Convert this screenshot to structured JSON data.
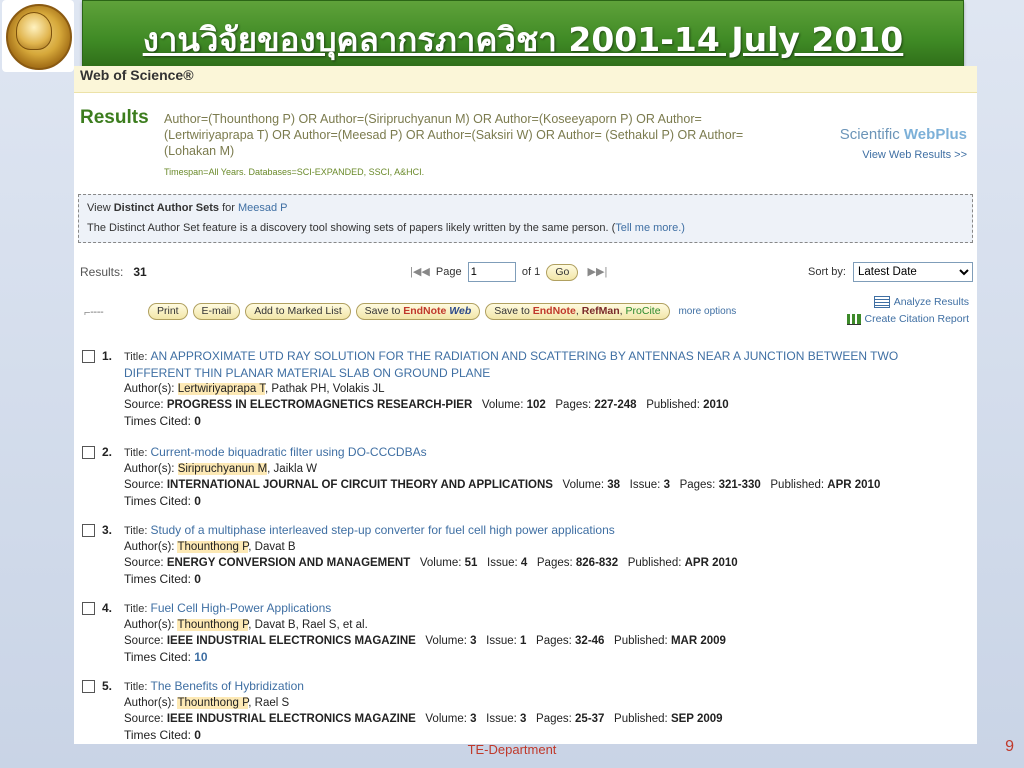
{
  "slide": {
    "title": "งานวิจัยของบุคลากรภาควิชา 2001-14 July 2010",
    "footer": "TE-Department",
    "page_number": "9"
  },
  "wos": {
    "header": "Web of Science®",
    "results_heading": "Results",
    "query": "Author=(Thounthong P) OR Author=(Siripruchyanun M) OR Author=(Koseeyaporn P) OR Author=(Lertwiriyaprapa T) OR Author=(Meesad P) OR Author=(Saksiri W) OR Author= (Sethakul P) OR Author=(Lohakan M)",
    "timespan": "Timespan=All Years. Databases=SCI-EXPANDED, SSCI, A&HCI.",
    "webplus_brand_a": "Scientific ",
    "webplus_brand_b": "WebPlus",
    "webplus_link": "View Web Results >>"
  },
  "distinct": {
    "prefix": "View ",
    "bold": "Distinct Author Sets",
    "for": " for ",
    "author": "Meesad P",
    "desc": "The Distinct Author Set feature is a discovery tool showing sets of papers likely written by the same person. (",
    "tell_more": "Tell me more.",
    "close_paren": ")"
  },
  "results_bar": {
    "label": "Results:",
    "count": "31",
    "first_prev": "|◀◀",
    "page_label": "Page",
    "page_value": "1",
    "of_total": "of 1",
    "go": "Go",
    "next_last": "▶▶|",
    "sort_label": "Sort by:",
    "sort_value": "Latest Date"
  },
  "toolbar": {
    "print": "Print",
    "email": "E-mail",
    "add_marked": "Add to Marked List",
    "save_to": "Save to ",
    "endnote": "EndNote",
    "web": "Web",
    "refman": "RefMan",
    "procite": "ProCite",
    "more": "more options",
    "analyze": "Analyze Results",
    "citation": "Create Citation Report"
  },
  "records": [
    {
      "num": "1.",
      "title": "AN APPROXIMATE UTD RAY SOLUTION FOR THE RADIATION AND SCATTERING BY ANTENNAS NEAR A JUNCTION BETWEEN TWO DIFFERENT THIN PLANAR MATERIAL SLAB ON GROUND PLANE",
      "author_hl": "Lertwiriyaprapa T",
      "author_rest": ", Pathak PH, Volakis JL",
      "source": "PROGRESS IN ELECTROMAGNETICS RESEARCH-PIER",
      "volume": "102",
      "issue": "",
      "pages": "227-248",
      "published": "2010",
      "cited": "0"
    },
    {
      "num": "2.",
      "title": "Current-mode biquadratic filter using DO-CCCDBAs",
      "author_hl": "Siripruchyanun M",
      "author_rest": ", Jaikla W",
      "source": "INTERNATIONAL JOURNAL OF CIRCUIT THEORY AND APPLICATIONS",
      "volume": "38",
      "issue": "3",
      "pages": "321-330",
      "published": "APR 2010",
      "cited": "0"
    },
    {
      "num": "3.",
      "title": "Study of a multiphase interleaved step-up converter for fuel cell high power applications",
      "author_hl": "Thounthong P",
      "author_rest": ", Davat B",
      "source": "ENERGY CONVERSION AND MANAGEMENT",
      "volume": "51",
      "issue": "4",
      "pages": "826-832",
      "published": "APR 2010",
      "cited": "0"
    },
    {
      "num": "4.",
      "title": "Fuel Cell High-Power Applications",
      "author_hl": "Thounthong P",
      "author_rest": ", Davat B, Rael S, et al.",
      "source": "IEEE INDUSTRIAL ELECTRONICS MAGAZINE",
      "volume": "3",
      "issue": "1",
      "pages": "32-46",
      "published": "MAR 2009",
      "cited": "10"
    },
    {
      "num": "5.",
      "title": "The Benefits of Hybridization",
      "author_hl": "Thounthong P",
      "author_rest": ", Rael S",
      "source": "IEEE INDUSTRIAL ELECTRONICS MAGAZINE",
      "volume": "3",
      "issue": "3",
      "pages": "25-37",
      "published": "SEP 2009",
      "cited": "0"
    }
  ],
  "labels": {
    "title": "Title: ",
    "authors": "Author(s): ",
    "source": "Source: ",
    "volume": "Volume: ",
    "issue": "Issue: ",
    "pages": "Pages: ",
    "published": "Published: ",
    "cited": "Times Cited: "
  }
}
